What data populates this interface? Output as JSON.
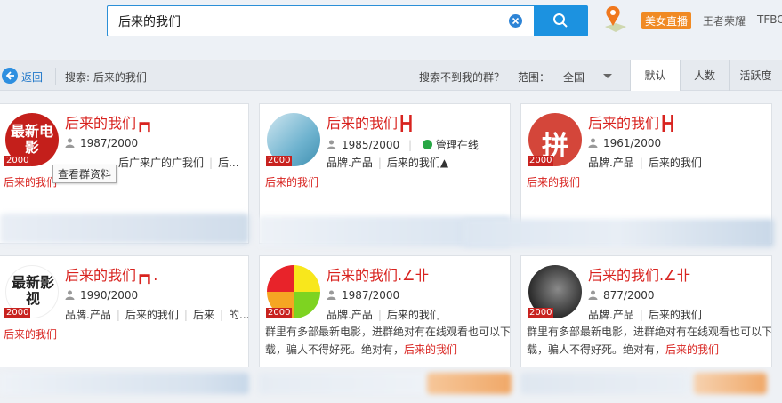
{
  "search": {
    "value": "后来的我们",
    "placeholder": ""
  },
  "top_links": {
    "live": "美女直播",
    "game": "王者荣耀",
    "tfboys": "TFBO"
  },
  "filter": {
    "back": "返回",
    "search_label": "搜索: 后来的我们",
    "not_found": "搜索不到我的群？",
    "range_label": "范围：",
    "range_value": "全国",
    "tabs": [
      "默认",
      "人数",
      "活跃度"
    ]
  },
  "tooltip": "查看群资料",
  "groups": [
    {
      "name": "后来的我们┏┓",
      "count": "1987/2000",
      "tags": [
        "后广来广的广我们",
        "后..."
      ],
      "avatar_text": "最新电影",
      "badge": "2000",
      "desc": "后来的我们"
    },
    {
      "name": "后来的我们┣┫",
      "count": "1985/2000",
      "online": "管理在线",
      "tags": [
        "品牌.产品",
        "后来的我们▲"
      ],
      "badge": "2000",
      "desc": "后来的我们"
    },
    {
      "name": "后来的我们┣┫",
      "count": "1961/2000",
      "tags": [
        "品牌.产品",
        "后来的我们"
      ],
      "avatar_text": "拼",
      "badge": "2000",
      "desc": "后来的我们"
    },
    {
      "name": "后来的我们┏┓.",
      "count": "1990/2000",
      "tags": [
        "品牌.产品",
        "后来的我们",
        "后来",
        "的..."
      ],
      "avatar_text": "最新影视",
      "badge": "2000",
      "desc": "后来的我们"
    },
    {
      "name": "后来的我们.∠卝",
      "count": "1987/2000",
      "tags": [
        "品牌.产品",
        "后来的我们"
      ],
      "badge": "2000",
      "desc_text": "群里有多部最新电影，进群绝对有在线观看也可以下载，骗人不得好死。绝对有，",
      "desc_hl": "后来的我们"
    },
    {
      "name": "后来的我们.∠卝",
      "count": "877/2000",
      "tags": [
        "品牌.产品",
        "后来的我们"
      ],
      "badge": "2000",
      "desc_text": "群里有多部最新电影，进群绝对有在线观看也可以下载，骗人不得好死。绝对有，",
      "desc_hl": "后来的我们"
    }
  ]
}
